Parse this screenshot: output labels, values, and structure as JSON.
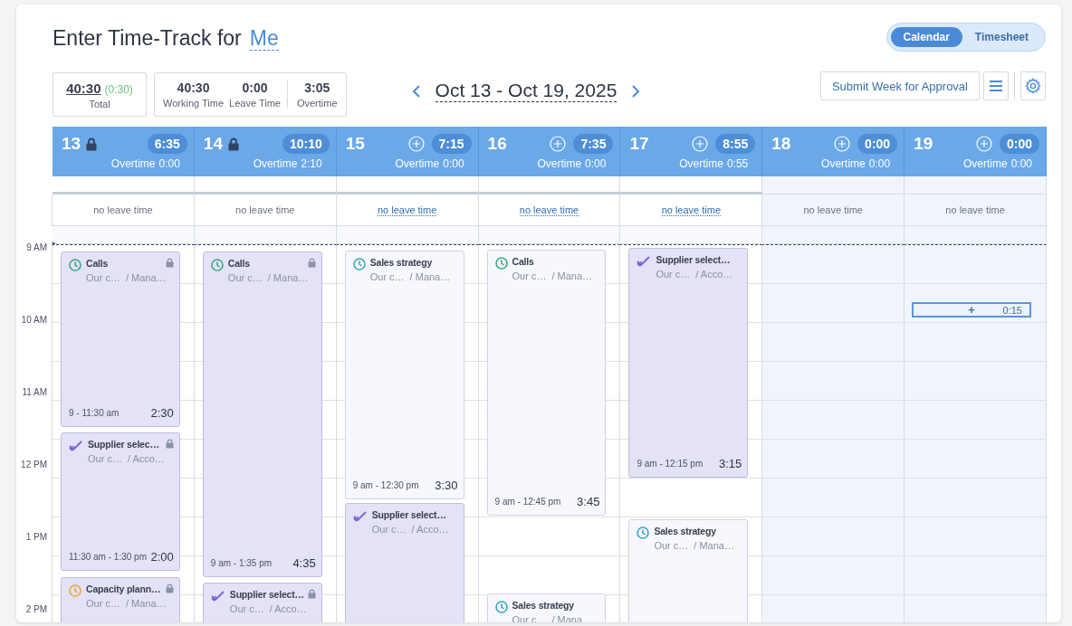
{
  "page": {
    "title": "Enter Time-Track for",
    "user": "Me"
  },
  "view_toggle": [
    {
      "label": "Calendar",
      "selected": true
    },
    {
      "label": "Timesheet",
      "selected": false
    }
  ],
  "summary": {
    "total": "40:30",
    "total_delta": "(0:30)",
    "total_label": "Total",
    "stats": [
      {
        "value": "40:30",
        "label": "Working Time"
      },
      {
        "value": "0:00",
        "label": "Leave Time"
      },
      {
        "value": "3:05",
        "label": "Overtime"
      }
    ]
  },
  "week": {
    "range": "Oct 13 - Oct 19, 2025"
  },
  "actions": {
    "submit": "Submit Week for Approval"
  },
  "time_labels": [
    "9 AM",
    "10 AM",
    "11 AM",
    "12 PM",
    "1 PM",
    "2 PM"
  ],
  "days": [
    {
      "number": "13",
      "locked": true,
      "disabled": false,
      "total": "6:35",
      "overtime_label": "Overtime",
      "overtime": "0:00",
      "leave": "no leave time",
      "leave_link": false,
      "entries": [
        {
          "kind": "clock",
          "color": "#3aaa7e",
          "title": "Calls",
          "project": "Our c…",
          "task": "/ Mana…",
          "locked": true,
          "submitted": true,
          "time_range": "9 - 11:30 am",
          "duration": "2:30"
        },
        {
          "kind": "check",
          "color": "#7a5fd6",
          "title": "Supplier selec…",
          "project": "Our c…",
          "task": "/ Acco…",
          "locked": true,
          "submitted": true,
          "time_range": "11:30 am - 1:30 pm",
          "duration": "2:00"
        },
        {
          "kind": "clock",
          "color": "#e8a838",
          "title": "Capacity plann…",
          "project": "Our c…",
          "task": "/ Mana…",
          "locked": true,
          "submitted": true
        }
      ]
    },
    {
      "number": "14",
      "locked": true,
      "disabled": false,
      "total": "10:10",
      "overtime_label": "Overtime",
      "overtime": "2:10",
      "leave": "no leave time",
      "leave_link": false,
      "entries": [
        {
          "kind": "clock",
          "color": "#3aaa7e",
          "title": "Calls",
          "project": "Our c…",
          "task": "/ Mana…",
          "locked": true,
          "submitted": true,
          "time_range": "9 am - 1:35 pm",
          "duration": "4:35"
        },
        {
          "kind": "check",
          "color": "#7a5fd6",
          "title": "Supplier select…",
          "project": "Our c…",
          "task": "/ Acco…",
          "locked": true,
          "submitted": true
        }
      ]
    },
    {
      "number": "15",
      "locked": false,
      "disabled": false,
      "total": "7:15",
      "overtime_label": "Overtime",
      "overtime": "0:00",
      "leave": "no leave time",
      "leave_link": true,
      "entries": [
        {
          "kind": "clock",
          "color": "#3aa6c4",
          "title": "Sales strategy",
          "project": "Our c…",
          "task": "/ Mana…",
          "locked": false,
          "submitted": false,
          "time_range": "9 am - 12:30 pm",
          "duration": "3:30"
        },
        {
          "kind": "check",
          "color": "#7a5fd6",
          "title": "Supplier select…",
          "project": "Our c…",
          "task": "/ Acco…",
          "locked": false,
          "submitted": true
        }
      ]
    },
    {
      "number": "16",
      "locked": false,
      "disabled": false,
      "total": "7:35",
      "overtime_label": "Overtime",
      "overtime": "0:00",
      "leave": "no leave time",
      "leave_link": true,
      "entries": [
        {
          "kind": "clock",
          "color": "#3aaa7e",
          "title": "Calls",
          "project": "Our c…",
          "task": "/ Mana…",
          "locked": false,
          "submitted": false,
          "time_range": "9 am - 12:45 pm",
          "duration": "3:45"
        },
        {
          "kind": "clock",
          "color": "#3aa6c4",
          "title": "Sales strategy",
          "project": "Our c…",
          "task": "/ Mana",
          "locked": false,
          "submitted": false
        }
      ]
    },
    {
      "number": "17",
      "locked": false,
      "disabled": false,
      "total": "8:55",
      "overtime_label": "Overtime",
      "overtime": "0:55",
      "leave": "no leave time",
      "leave_link": true,
      "entries": [
        {
          "kind": "check",
          "color": "#7a5fd6",
          "title": "Supplier select…",
          "project": "Our c…",
          "task": "/ Acco…",
          "locked": false,
          "submitted": true,
          "time_range": "9 am - 12:15 pm",
          "duration": "3:15"
        },
        {
          "kind": "clock",
          "color": "#3aa6c4",
          "title": "Sales strategy",
          "project": "Our c…",
          "task": "/ Mana…",
          "locked": false,
          "submitted": false
        }
      ]
    },
    {
      "number": "18",
      "locked": false,
      "disabled": true,
      "total": "0:00",
      "overtime_label": "Overtime",
      "overtime": "0:00",
      "leave": "no leave time",
      "leave_link": false
    },
    {
      "number": "19",
      "locked": false,
      "disabled": true,
      "total": "0:00",
      "overtime_label": "Overtime",
      "overtime": "0:00",
      "leave": "no leave time",
      "leave_link": false,
      "new_slot": {
        "plus": "+",
        "duration": "0:15"
      }
    }
  ]
}
